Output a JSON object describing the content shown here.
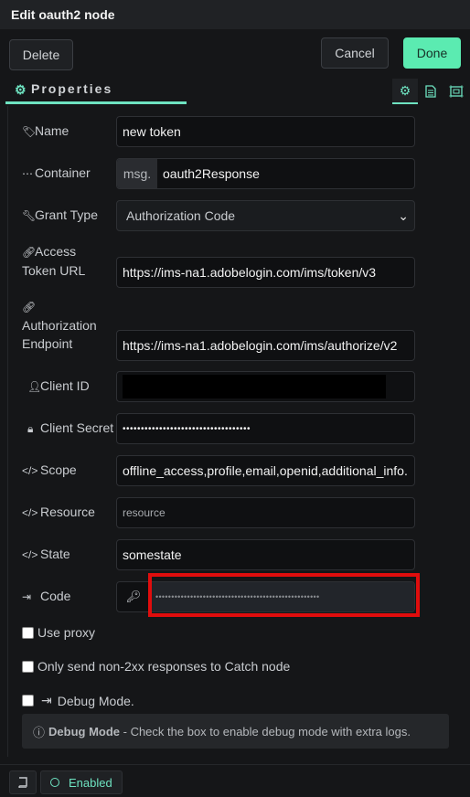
{
  "window": {
    "title": "Edit oauth2 node"
  },
  "toolbar": {
    "delete_label": "Delete",
    "cancel_label": "Cancel",
    "done_label": "Done"
  },
  "tabs": {
    "properties_label": "Properties",
    "icons": [
      "gear-icon",
      "document-icon",
      "frame-icon"
    ]
  },
  "form": {
    "name": {
      "label": "Name",
      "value": "new token"
    },
    "container": {
      "label": "Container",
      "prefix": "msg.",
      "value": "oauth2Response"
    },
    "grant_type": {
      "label": "Grant Type",
      "value": "Authorization Code",
      "chevron": "⌄"
    },
    "access_token_url": {
      "label_line1": "Access",
      "label_line2": "Token URL",
      "value": "https://ims-na1.adobelogin.com/ims/token/v3"
    },
    "authorization_endpoint": {
      "label_line1": "Authorization",
      "label_line2": "Endpoint",
      "value": "https://ims-na1.adobelogin.com/ims/authorize/v2"
    },
    "client_id": {
      "label": "Client ID",
      "value": ""
    },
    "client_secret": {
      "label": "Client Secret",
      "value": "•••••••••••••••••••••••••••••••••••"
    },
    "scope": {
      "label": "Scope",
      "value": "offline_access,profile,email,openid,additional_info."
    },
    "resource": {
      "label": "Resource",
      "placeholder": "resource"
    },
    "state": {
      "label": "State",
      "value": "somestate"
    },
    "code": {
      "label": "Code",
      "key_glyph": "🔑︎",
      "value": "••••••••••••••••••••••••••••••••••••••••••••••••••••"
    },
    "use_proxy": {
      "label": "Use proxy"
    },
    "only_non_2xx": {
      "label": "Only send non-2xx responses to Catch node"
    },
    "debug_mode": {
      "label": "Debug Mode."
    }
  },
  "info": {
    "title": "Debug Mode",
    "text": " - Check the box to enable debug mode with extra logs."
  },
  "footer": {
    "status_label": "Enabled"
  },
  "colors": {
    "accent": "#6ee3c1",
    "done": "#5bebb1",
    "highlight": "#e00d0d"
  }
}
